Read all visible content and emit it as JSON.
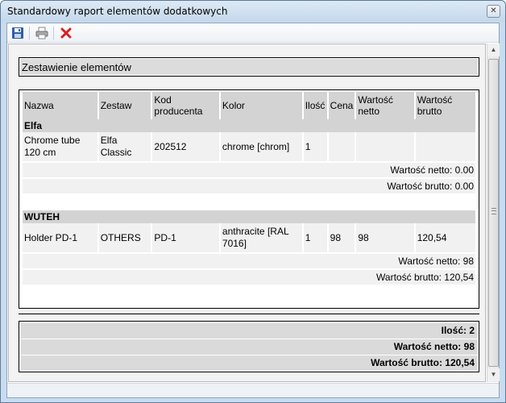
{
  "window": {
    "title": "Standardowy raport elementów dodatkowych",
    "close_glyph": "✕"
  },
  "toolbar": {
    "buttons": [
      {
        "icon": "save-icon"
      },
      {
        "icon": "print-icon"
      },
      {
        "icon": "delete-icon",
        "color": "#d92020"
      }
    ]
  },
  "report": {
    "section_title": "Zestawienie elementów",
    "columns": [
      "Nazwa",
      "Zestaw",
      "Kod producenta",
      "Kolor",
      "Ilość",
      "Cena",
      "Wartość netto",
      "Wartość brutto"
    ],
    "groups": [
      {
        "name": "Elfa",
        "rows": [
          {
            "nazwa": "Chrome tube 120 cm",
            "zestaw": "Elfa Classic",
            "kod": "202512",
            "kolor": "chrome [chrom]",
            "ilosc": "1",
            "cena": "",
            "netto": "",
            "brutto": ""
          }
        ],
        "sum_netto": "Wartość netto: 0.00",
        "sum_brutto": "Wartość brutto: 0.00"
      },
      {
        "name": "WUTEH",
        "rows": [
          {
            "nazwa": "Holder PD-1",
            "zestaw": "OTHERS",
            "kod": "PD-1",
            "kolor": "anthracite [RAL 7016]",
            "ilosc": "1",
            "cena": "98",
            "netto": "98",
            "brutto": "120,54"
          }
        ],
        "sum_netto": "Wartość netto: 98",
        "sum_brutto": "Wartość brutto: 120,54"
      }
    ],
    "totals": {
      "ilosc": "Ilość: 2",
      "netto": "Wartość netto: 98",
      "brutto": "Wartość brutto: 120,54"
    }
  },
  "scrollbar": {
    "up_glyph": "▲",
    "down_glyph": "▼"
  },
  "colors": {
    "window_frame": "#c9dcef",
    "header_cell": "#d3d3d3",
    "data_cell": "#f1f1f1",
    "delete_icon": "#d92020"
  }
}
